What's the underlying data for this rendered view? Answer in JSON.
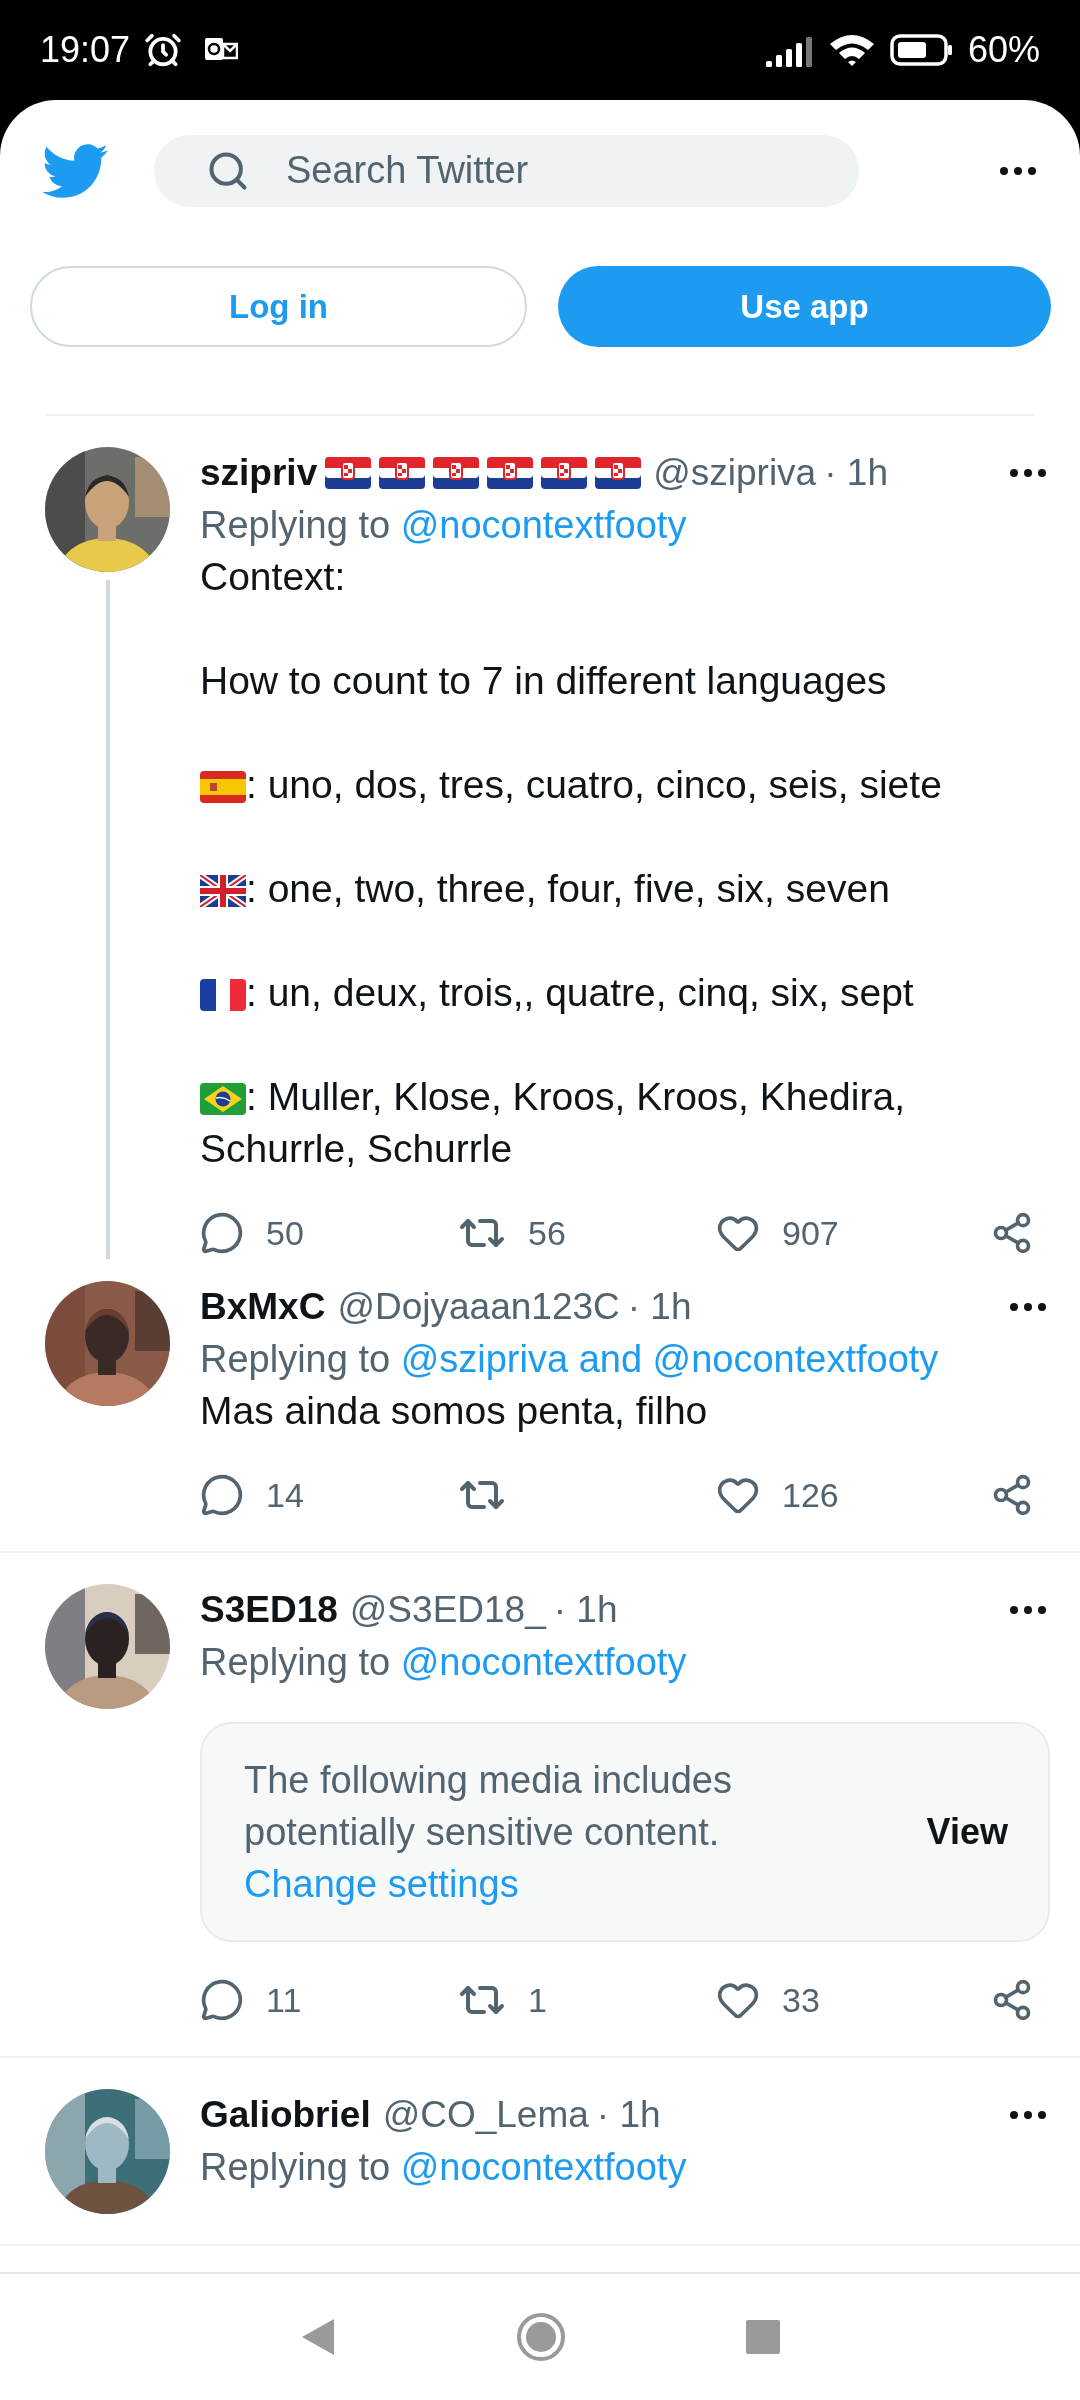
{
  "status_bar": {
    "time": "19:07",
    "battery": "60%"
  },
  "header": {
    "search": {
      "placeholder": "Search Twitter"
    },
    "login": "Log in",
    "use_app": "Use app"
  },
  "tweets": [
    {
      "name": "szipriv",
      "name_flags": [
        {
          "kind": "hr"
        },
        {
          "kind": "hr"
        },
        {
          "kind": "hr"
        },
        {
          "kind": "hr"
        },
        {
          "kind": "hr"
        },
        {
          "kind": "hr"
        }
      ],
      "handle": "@szipriva",
      "time": "· 1h",
      "replying_label": "Replying to",
      "replying_to": "@nocontextfooty",
      "thread": true,
      "body": [
        {
          "text": "Context:"
        },
        {
          "text": "How to count to 7 in different languages"
        },
        {
          "flag": {
            "kind": "es"
          },
          "text": ": uno, dos, tres, cuatro, cinco, seis, siete"
        },
        {
          "flag": {
            "kind": "gb"
          },
          "text": ": one, two, three, four, five, six, seven"
        },
        {
          "flag": {
            "kind": "fr"
          },
          "text": ": un, deux, trois,, quatre, cinq, six, sept"
        },
        {
          "flag": {
            "kind": "br"
          },
          "text": ": Muller, Klose, Kroos, Kroos, Khedira, Schurrle, Schurrle"
        }
      ],
      "replies": "50",
      "retweets": "56",
      "likes": "907"
    },
    {
      "name": "BxMxC",
      "handle": "@Dojyaaan123C",
      "time": "· 1h",
      "replying_label": "Replying to",
      "replying_to": "@szipriva and @nocontextfooty",
      "thread": false,
      "body": [
        {
          "text": "Mas ainda somos penta, filho"
        }
      ],
      "replies": "14",
      "likes": "126"
    },
    {
      "name": "S3ED18",
      "handle": "@S3ED18_",
      "time": "· 1h",
      "replying_label": "Replying to",
      "replying_to": "@nocontextfooty",
      "thread": false,
      "media_notice": {
        "text": "The following media includes potentially sensitive content.",
        "link": "Change settings",
        "button": "View"
      },
      "replies": "11",
      "retweets": "1",
      "likes": "33"
    },
    {
      "name": "Galiobriel",
      "handle": "@CO_Lema",
      "time": "· 1h",
      "replying_label": "Replying to",
      "replying_to": "@nocontextfooty",
      "thread": false
    }
  ]
}
